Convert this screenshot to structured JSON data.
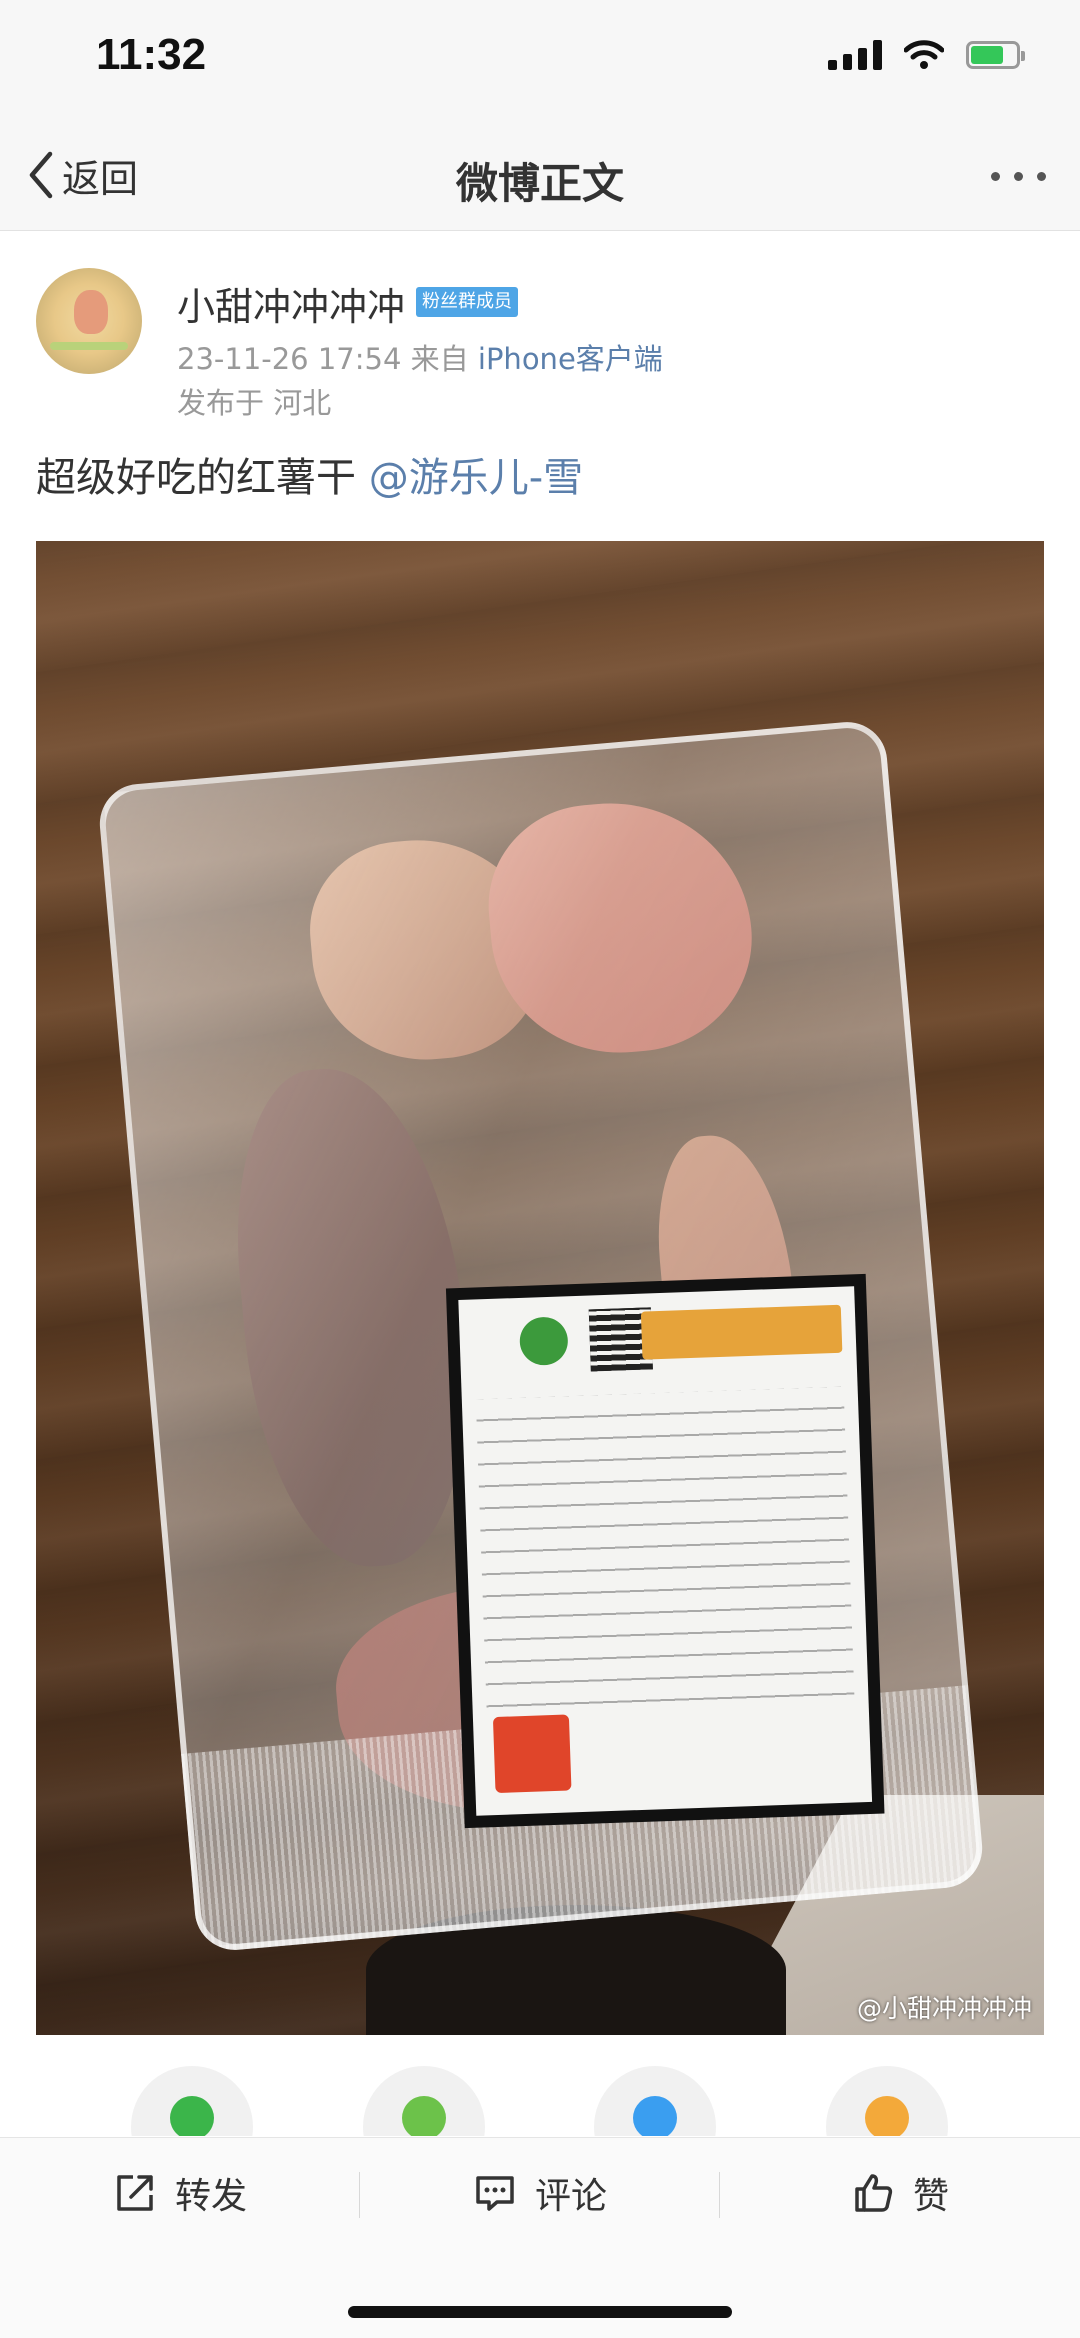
{
  "status_bar": {
    "time": "11:32"
  },
  "nav": {
    "back_label": "返回",
    "title": "微博正文"
  },
  "post": {
    "author": "小甜冲冲冲冲",
    "badge": "粉丝群成员",
    "timestamp": "23-11-26 17:54",
    "source_prefix": "来自",
    "source": "iPhone客户端",
    "location": "发布于 河北",
    "text": "超级好吃的红薯干",
    "mention": "@游乐儿-雪",
    "watermark": "@小甜冲冲冲冲"
  },
  "share_targets": [
    {
      "name": "wechat",
      "color": "#3bb54a"
    },
    {
      "name": "moments",
      "color": "#6cc24a"
    },
    {
      "name": "qq",
      "color": "#3a9ef0"
    },
    {
      "name": "qzone",
      "color": "#f3a93a"
    }
  ],
  "actions": {
    "repost": "转发",
    "comment": "评论",
    "like": "赞"
  }
}
